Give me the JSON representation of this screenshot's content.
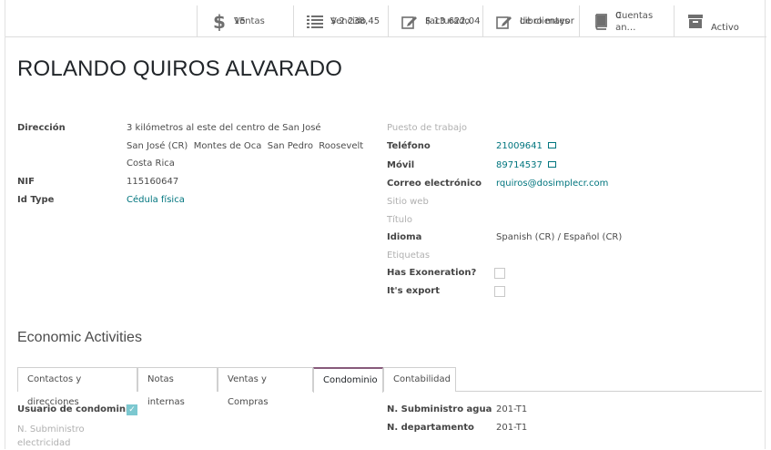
{
  "smart_buttons": {
    "sales": {
      "value": "15",
      "label": "Ventas",
      "icon": "dollar-icon"
    },
    "due": {
      "value": "$ 2 238,45",
      "label": "Vencido",
      "icon": "list-icon"
    },
    "invoiced": {
      "value": "$ 13 622,04",
      "label": "Facturado",
      "icon": "edit-icon"
    },
    "ledger": {
      "value": "Libro mayor",
      "label": "de clientes",
      "icon": "edit-icon"
    },
    "accounts": {
      "value": "0",
      "label": "Cuentas an…",
      "icon": "book-icon"
    },
    "active": {
      "label": "Activo",
      "icon": "archive-icon"
    }
  },
  "partner_name": "ROLANDO QUIROS ALVARADO",
  "left_fields": {
    "address_label": "Dirección",
    "address_line1": "3 kilómetros al este del centro de San José",
    "address_line2": "San José (CR)  Montes de Oca  San Pedro  Roosevelt",
    "address_line3": "Costa Rica",
    "nif_label": "NIF",
    "nif_value": "115160647",
    "idtype_label": "Id Type",
    "idtype_value": "Cédula física"
  },
  "right_fields": {
    "job_label": "Puesto de trabajo",
    "phone_label": "Teléfono",
    "phone_value": "21009641",
    "mobile_label": "Móvil",
    "mobile_value": "89714537",
    "email_label": "Correo electrónico",
    "email_value": "rquiros@dosimplecr.com",
    "website_label": "Sitio web",
    "title_label": "Título",
    "lang_label": "Idioma",
    "lang_value": "Spanish (CR) / Español (CR)",
    "tags_label": "Etiquetas",
    "exoneration_label": "Has Exoneration?",
    "export_label": "It's export"
  },
  "section_title": "Economic Activities",
  "tabs": [
    {
      "label": "Contactos y direcciones"
    },
    {
      "label": "Notas internas"
    },
    {
      "label": "Ventas y Compras"
    },
    {
      "label": "Condominio"
    },
    {
      "label": "Contabilidad"
    }
  ],
  "condo": {
    "user_label": "Usuario de condominio",
    "user_checked": true,
    "elec_label_1": "N. Subministro",
    "elec_label_2": "electricidad",
    "water_label": "N. Subministro agua",
    "water_value": "201-T1",
    "dept_label": "N. departamento",
    "dept_value": "201-T1"
  },
  "colors": {
    "accent": "#875a7b",
    "link": "#00757e",
    "active": "#00a04a"
  }
}
